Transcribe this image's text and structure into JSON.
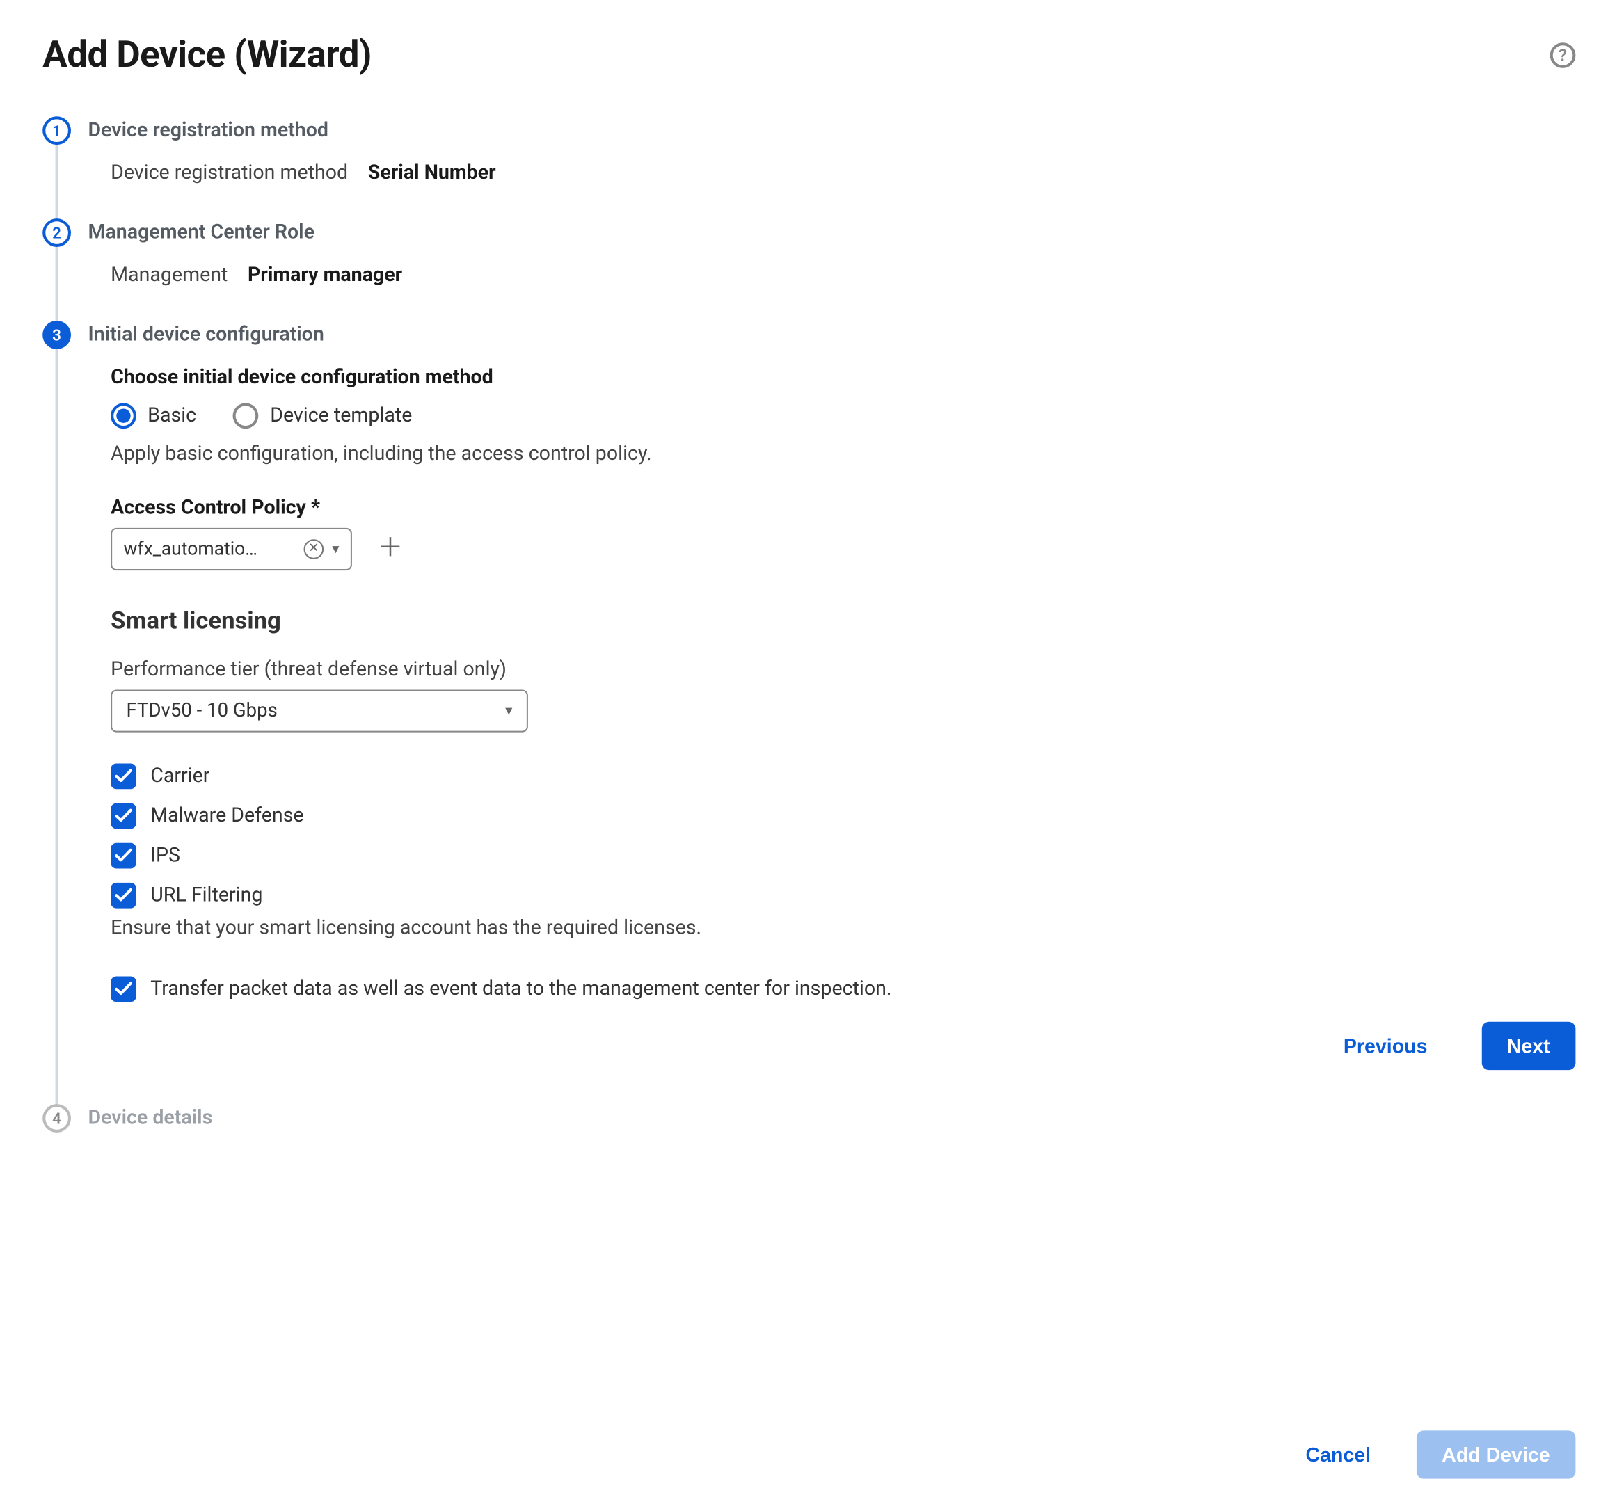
{
  "title": "Add Device (Wizard)",
  "steps": {
    "s1": {
      "num": "1",
      "title": "Device registration method",
      "kv_label": "Device registration method",
      "kv_value": "Serial Number"
    },
    "s2": {
      "num": "2",
      "title": "Management Center Role",
      "kv_label": "Management",
      "kv_value": "Primary manager"
    },
    "s3": {
      "num": "3",
      "title": "Initial device configuration",
      "choose_label": "Choose initial device configuration method",
      "radio_basic": "Basic",
      "radio_template": "Device template",
      "helper": "Apply basic configuration, including the access control policy.",
      "acp_label": "Access Control Policy *",
      "acp_value": "wfx_automatio…",
      "smart_heading": "Smart licensing",
      "tier_label": "Performance tier (threat defense virtual only)",
      "tier_value": "FTDv50 - 10 Gbps",
      "licenses": {
        "carrier": "Carrier",
        "malware": "Malware Defense",
        "ips": "IPS",
        "url": "URL Filtering"
      },
      "license_note": "Ensure that your smart licensing account has the required licenses.",
      "transfer_label": "Transfer packet data as well as event data to the management center for inspection.",
      "prev": "Previous",
      "next": "Next"
    },
    "s4": {
      "num": "4",
      "title": "Device details"
    }
  },
  "footer": {
    "cancel": "Cancel",
    "add": "Add Device"
  }
}
